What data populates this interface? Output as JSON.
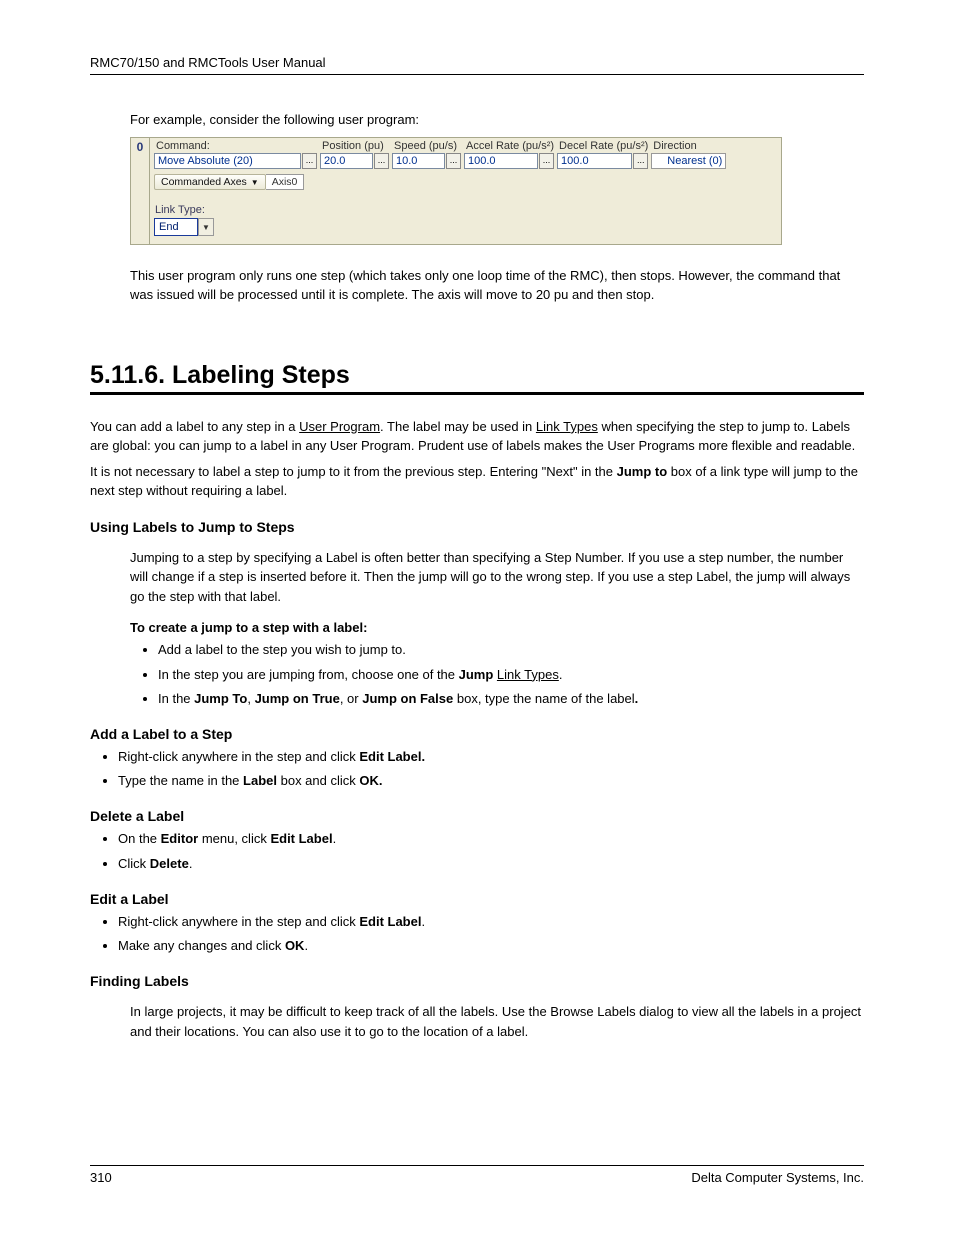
{
  "header": "RMC70/150 and RMCTools User Manual",
  "intro_before_box": "For example, consider the following user program:",
  "step": {
    "num": "0",
    "fields": {
      "command": {
        "label": "Command:",
        "value": "Move Absolute (20)"
      },
      "position": {
        "label": "Position (pu)",
        "value": "20.0"
      },
      "speed": {
        "label": "Speed (pu/s)",
        "value": "10.0"
      },
      "accel": {
        "label": "Accel Rate (pu/s²)",
        "value": "100.0"
      },
      "decel": {
        "label": "Decel Rate (pu/s²)",
        "value": "100.0"
      },
      "direction": {
        "label": "Direction",
        "value": "Nearest (0)"
      }
    },
    "axes": {
      "button": "Commanded Axes",
      "value": "Axis0"
    },
    "link": {
      "label": "Link Type:",
      "value": "End"
    }
  },
  "after_box": "This user program only runs one step (which takes only one loop time of the RMC), then stops. However, the command that was issued will be processed until it is complete. The axis will move to 20 pu and then stop.",
  "section_title": "5.11.6. Labeling Steps",
  "sec_para1_parts": {
    "a": "You can add a label to any step in a ",
    "link1": "User Program",
    "b": ". The label may be used in ",
    "link2": "Link Types",
    "c": " when specifying the step to jump to. Labels are global: you can jump to a label in any User Program. Prudent use of labels makes the User Programs more flexible and readable."
  },
  "sec_para2_parts": {
    "a": "It is not necessary to label a step to jump to it from the previous step. Entering \"Next\" in the ",
    "bold": "Jump to",
    "b": " box of a link type will jump to the next step without requiring a label."
  },
  "sub_using": {
    "title": "Using Labels to Jump to Steps",
    "para": "Jumping to a step by specifying a Label is often better than specifying a Step Number. If you use a step number, the number will change if a step is inserted before it. Then the jump will go to the wrong step. If you use a step Label, the jump will always go the step with that label.",
    "to_create": "To create a jump to a step with a label:",
    "bul1": "Add a label to the step you wish to jump to.",
    "bul2_a": "In the step you are jumping from, choose one of the ",
    "bul2_bold": "Jump",
    "bul2_b": " ",
    "bul2_link": "Link Types",
    "bul2_c": ".",
    "bul3_a": "In the ",
    "bul3_b1": "Jump To",
    "bul3_comma1": ", ",
    "bul3_b2": "Jump on True",
    "bul3_comma2": ", or ",
    "bul3_b3": "Jump on False",
    "bul3_c": " box, type the name of the label",
    "bul3_d": "."
  },
  "sub_add": {
    "title": "Add a Label to a Step",
    "bul1_a": "Right-click anywhere in the step and click ",
    "bul1_bold": "Edit Label.",
    "bul2_a": "Type the name in the ",
    "bul2_bold1": "Label",
    "bul2_b": " box and click ",
    "bul2_bold2": "OK."
  },
  "sub_del": {
    "title": "Delete a Label",
    "bul1_a": "On the ",
    "bul1_bold1": "Editor",
    "bul1_b": " menu, click ",
    "bul1_bold2": "Edit Label",
    "bul1_c": ".",
    "bul2_a": "Click ",
    "bul2_bold": "Delete",
    "bul2_b": "."
  },
  "sub_edit": {
    "title": "Edit a Label",
    "bul1_a": "Right-click anywhere in the step and click ",
    "bul1_bold": "Edit Label",
    "bul1_b": ".",
    "bul2_a": "Make any changes and click ",
    "bul2_bold": "OK",
    "bul2_b": "."
  },
  "sub_find": {
    "title": "Finding Labels",
    "para": "In large projects, it may be difficult to keep track of all the labels. Use the Browse Labels dialog to view all the labels in a project and their locations. You can also use it to go to the location of a label."
  },
  "footer": {
    "page": "310",
    "company": "Delta Computer Systems, Inc."
  }
}
